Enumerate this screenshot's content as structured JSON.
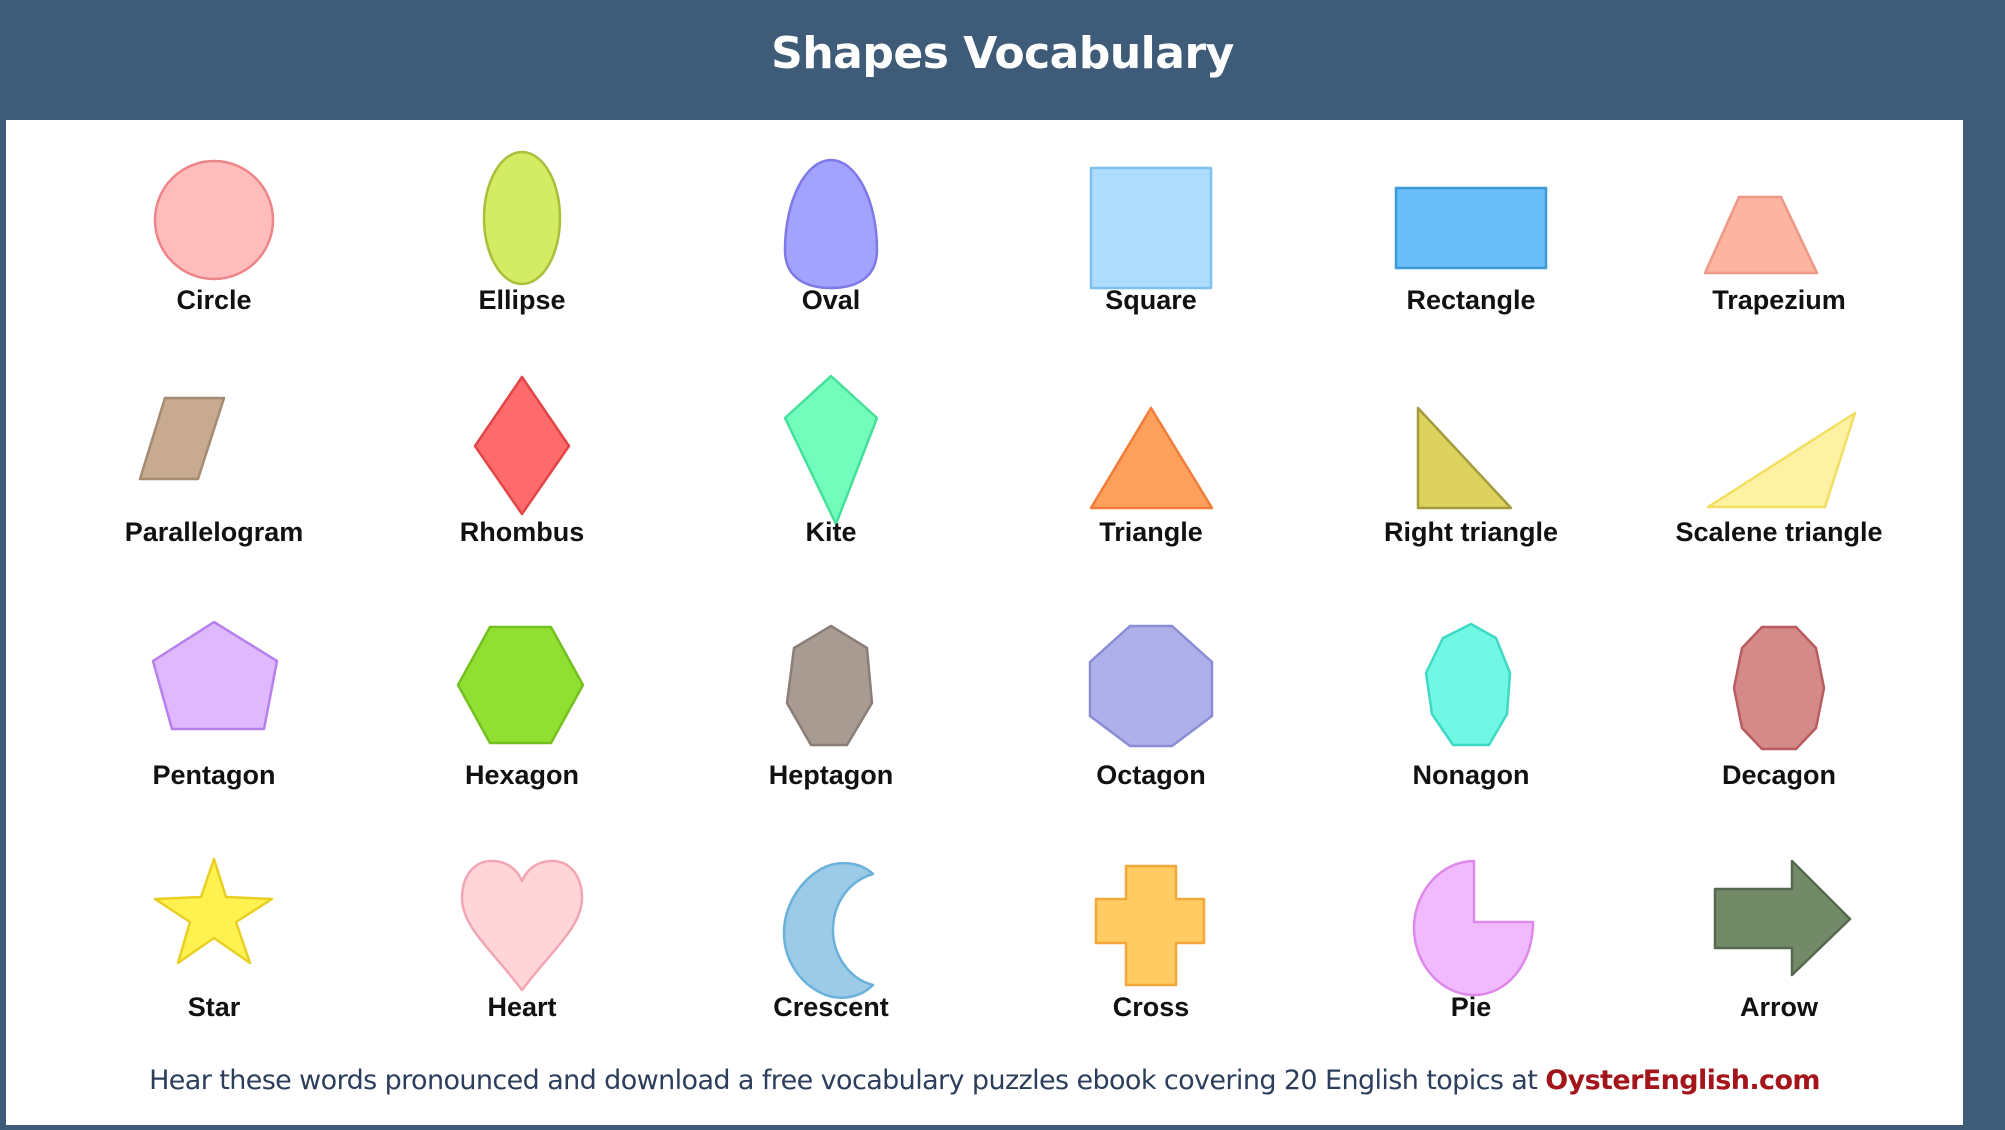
{
  "header": {
    "title": "Shapes Vocabulary"
  },
  "shapes": [
    {
      "label": "Circle",
      "icon": "circle-shape-icon",
      "fill": "#ffbcbd",
      "stroke": "#ee8488"
    },
    {
      "label": "Ellipse",
      "icon": "ellipse-shape-icon",
      "fill": "#d4ec64",
      "stroke": "#a8bf3a"
    },
    {
      "label": "Oval",
      "icon": "oval-shape-icon",
      "fill": "#a3a2fe",
      "stroke": "#7d79e8"
    },
    {
      "label": "Square",
      "icon": "square-shape-icon",
      "fill": "#aedcfc",
      "stroke": "#7ec0ee"
    },
    {
      "label": "Rectangle",
      "icon": "rectangle-shape-icon",
      "fill": "#68bef8",
      "stroke": "#3d9ad8"
    },
    {
      "label": "Trapezium",
      "icon": "trapezium-shape-icon",
      "fill": "#fdb4a0",
      "stroke": "#ee9886"
    },
    {
      "label": "Parallelogram",
      "icon": "parallelogram-shape-icon",
      "fill": "#c7aa8f",
      "stroke": "#a48b72"
    },
    {
      "label": "Rhombus",
      "icon": "rhombus-shape-icon",
      "fill": "#fe6b6c",
      "stroke": "#e24547"
    },
    {
      "label": "Kite",
      "icon": "kite-shape-icon",
      "fill": "#72fdbd",
      "stroke": "#47e09a"
    },
    {
      "label": "Triangle",
      "icon": "triangle-shape-icon",
      "fill": "#fda05c",
      "stroke": "#f07d3a"
    },
    {
      "label": "Right triangle",
      "icon": "right-triangle-shape-icon",
      "fill": "#dcd25d",
      "stroke": "#a49c3c"
    },
    {
      "label": "Scalene triangle",
      "icon": "scalene-triangle-shape-icon",
      "fill": "#fdf1a2",
      "stroke": "#f2df62"
    },
    {
      "label": "Pentagon",
      "icon": "pentagon-shape-icon",
      "fill": "#dfb8fd",
      "stroke": "#b880ec"
    },
    {
      "label": "Hexagon",
      "icon": "hexagon-shape-icon",
      "fill": "#91e031",
      "stroke": "#74c020"
    },
    {
      "label": "Heptagon",
      "icon": "heptagon-shape-icon",
      "fill": "#a89b92",
      "stroke": "#8a7e76"
    },
    {
      "label": "Octagon",
      "icon": "octagon-shape-icon",
      "fill": "#afb0e9",
      "stroke": "#8a8cd4"
    },
    {
      "label": "Nonagon",
      "icon": "nonagon-shape-icon",
      "fill": "#71f8e4",
      "stroke": "#3ed9c4"
    },
    {
      "label": "Decagon",
      "icon": "decagon-shape-icon",
      "fill": "#d58a8a",
      "stroke": "#b85c60"
    },
    {
      "label": "Star",
      "icon": "star-shape-icon",
      "fill": "#fef250",
      "stroke": "#e8cf22"
    },
    {
      "label": "Heart",
      "icon": "heart-shape-icon",
      "fill": "#ffd5d9",
      "stroke": "#f2a6b4"
    },
    {
      "label": "Crescent",
      "icon": "crescent-shape-icon",
      "fill": "#9ccbe8",
      "stroke": "#6ab2da"
    },
    {
      "label": "Cross",
      "icon": "cross-shape-icon",
      "fill": "#ffcb62",
      "stroke": "#f2a83a"
    },
    {
      "label": "Pie",
      "icon": "pie-shape-icon",
      "fill": "#f2bafe",
      "stroke": "#de88ec"
    },
    {
      "label": "Arrow",
      "icon": "arrow-shape-icon",
      "fill": "#738a68",
      "stroke": "#56694e"
    }
  ],
  "footer": {
    "text": "Hear these words pronounced and download a free vocabulary puzzles ebook covering 20 English topics at ",
    "link": "OysterEnglish.com"
  },
  "colors": {
    "header_bg": "#3e5c78",
    "footer_text": "#2c3e5c",
    "link": "#a3151b"
  }
}
